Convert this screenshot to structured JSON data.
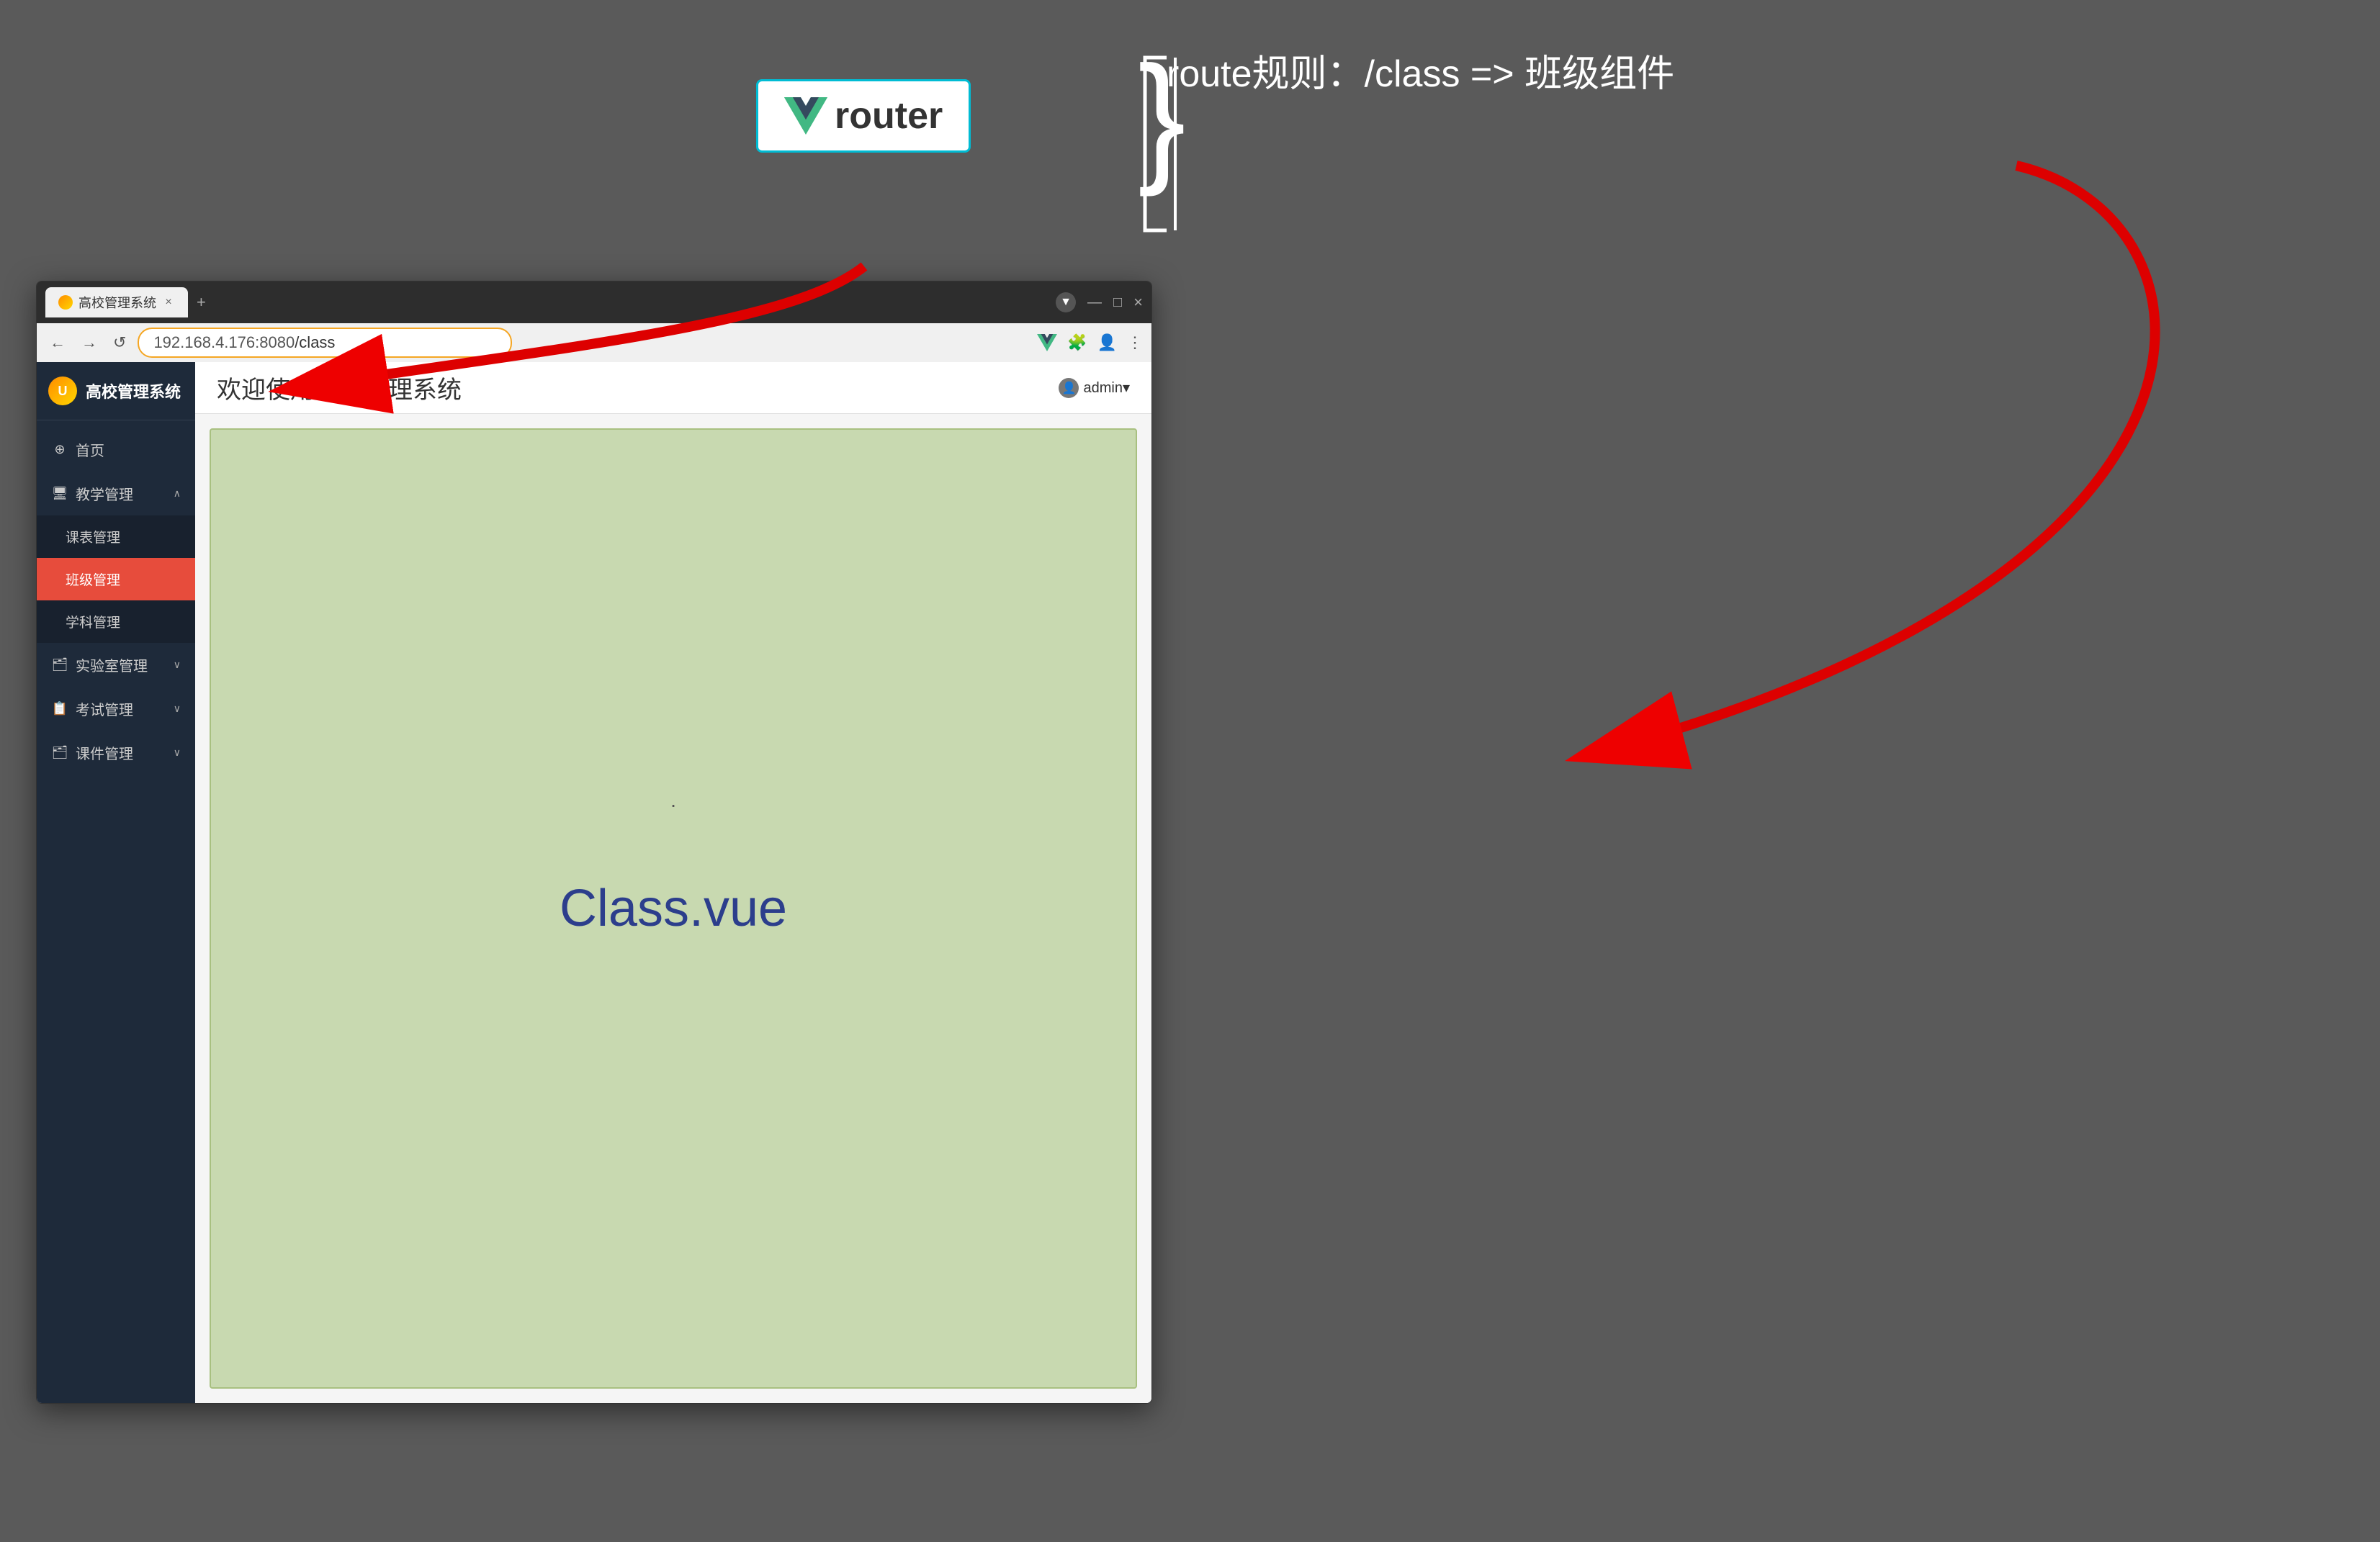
{
  "background_color": "#5a5a5a",
  "annotation": {
    "router_label": "router",
    "vue_logo_path": "V",
    "route_rule": "route规则：/class =>  班级组件",
    "bracket": "{"
  },
  "browser": {
    "tab_title": "高校管理系统",
    "tab_close": "×",
    "new_tab": "+",
    "window_controls": [
      "—",
      "□",
      "×"
    ],
    "address": "192.168.4.176:8080",
    "address_path": "/class",
    "nav_back": "←",
    "nav_forward": "→",
    "nav_reload": "↺"
  },
  "app": {
    "logo_text": "高校管理系统",
    "header_title": "欢迎使用高校管理系统",
    "admin_label": "admin▾",
    "sidebar": {
      "items": [
        {
          "id": "home",
          "icon": "⊕",
          "label": "首页",
          "active": false
        },
        {
          "id": "teaching",
          "icon": "🖥",
          "label": "教学管理",
          "active": false,
          "expanded": true,
          "arrow": "∧"
        },
        {
          "id": "course-table",
          "icon": "",
          "label": "课表管理",
          "active": false,
          "submenu": true
        },
        {
          "id": "class",
          "icon": "",
          "label": "班级管理",
          "active": true,
          "submenu": true
        },
        {
          "id": "subject",
          "icon": "",
          "label": "学科管理",
          "active": false,
          "submenu": true
        },
        {
          "id": "lab",
          "icon": "🗂",
          "label": "实验室管理",
          "active": false,
          "arrow": "∨"
        },
        {
          "id": "exam",
          "icon": "📋",
          "label": "考试管理",
          "active": false,
          "arrow": "∨"
        },
        {
          "id": "courseware",
          "icon": "🗂",
          "label": "课件管理",
          "active": false,
          "arrow": "∨"
        }
      ]
    },
    "class_component": {
      "dot": "·",
      "text": "Class.vue"
    }
  }
}
